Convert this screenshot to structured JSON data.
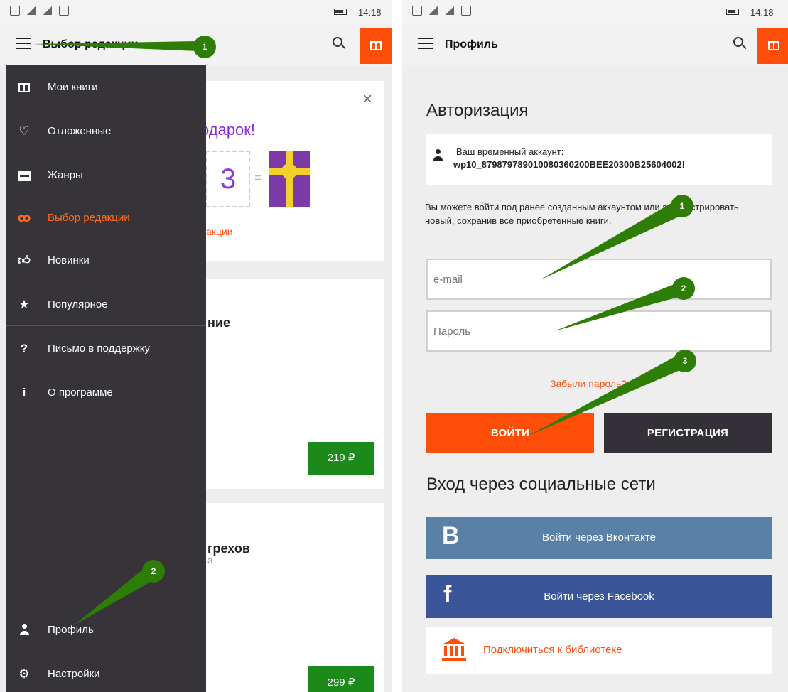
{
  "colors": {
    "accent": "#ff4e0a",
    "drawer_bg": "#363339",
    "vk": "#5980a6",
    "facebook": "#3a5598",
    "price_green": "#1b8a1b",
    "annotation_green": "#2d7d06"
  },
  "left_screen": {
    "status_time": "14:18",
    "appbar_title": "Выбор редакции",
    "books_button_icon": "book-icon",
    "promo": {
      "title": "одарок!",
      "number": "3",
      "equals": "=",
      "link": "акции",
      "close": "×"
    },
    "books": [
      {
        "title_fragment": "ние",
        "price": "219 ₽"
      },
      {
        "title_fragment": "грехов",
        "subtitle_fragment": "а",
        "price": "299 ₽"
      }
    ],
    "drawer": {
      "items": [
        {
          "label": "Мои книги",
          "icon": "book-icon"
        },
        {
          "label": "Отложенные",
          "icon": "heart-icon"
        },
        {
          "label": "Жанры",
          "icon": "drawer-icon"
        },
        {
          "label": "Выбор редакции",
          "icon": "glasses-icon",
          "active": true
        },
        {
          "label": "Новинки",
          "icon": "thumbs-up-icon"
        },
        {
          "label": "Популярное",
          "icon": "star-icon"
        },
        {
          "label": "Письмо в поддержку",
          "icon": "question-icon"
        },
        {
          "label": "О программе",
          "icon": "info-icon"
        },
        {
          "label": "Профиль",
          "icon": "person-icon"
        },
        {
          "label": "Настройки",
          "icon": "gear-icon"
        }
      ]
    },
    "markers": [
      "1",
      "2"
    ]
  },
  "right_screen": {
    "status_time": "14:18",
    "appbar_title": "Профиль",
    "auth_title": "Авторизация",
    "account_label": "Ваш временный аккаунт:",
    "account_id": "wp10_879879789010080360200BEE20300B25604002!",
    "info_text": "Вы можете войти под ранее созданным аккаунтом или зарегистрировать новый, сохранив все приобретенные книги.",
    "email_placeholder": "e-mail",
    "password_placeholder": "Пароль",
    "forgot_password": "Забыли пароль?",
    "login_button": "ВОЙТИ",
    "register_button": "РЕГИСТРАЦИЯ",
    "social_title": "Вход через социальные сети",
    "vk_icon": "В",
    "vk_label": "Войти через Вконтакте",
    "fb_icon": "f",
    "fb_label": "Войти через Facebook",
    "library_label": "Подключиться к библиотеке",
    "markers": [
      "1",
      "2",
      "3"
    ]
  }
}
